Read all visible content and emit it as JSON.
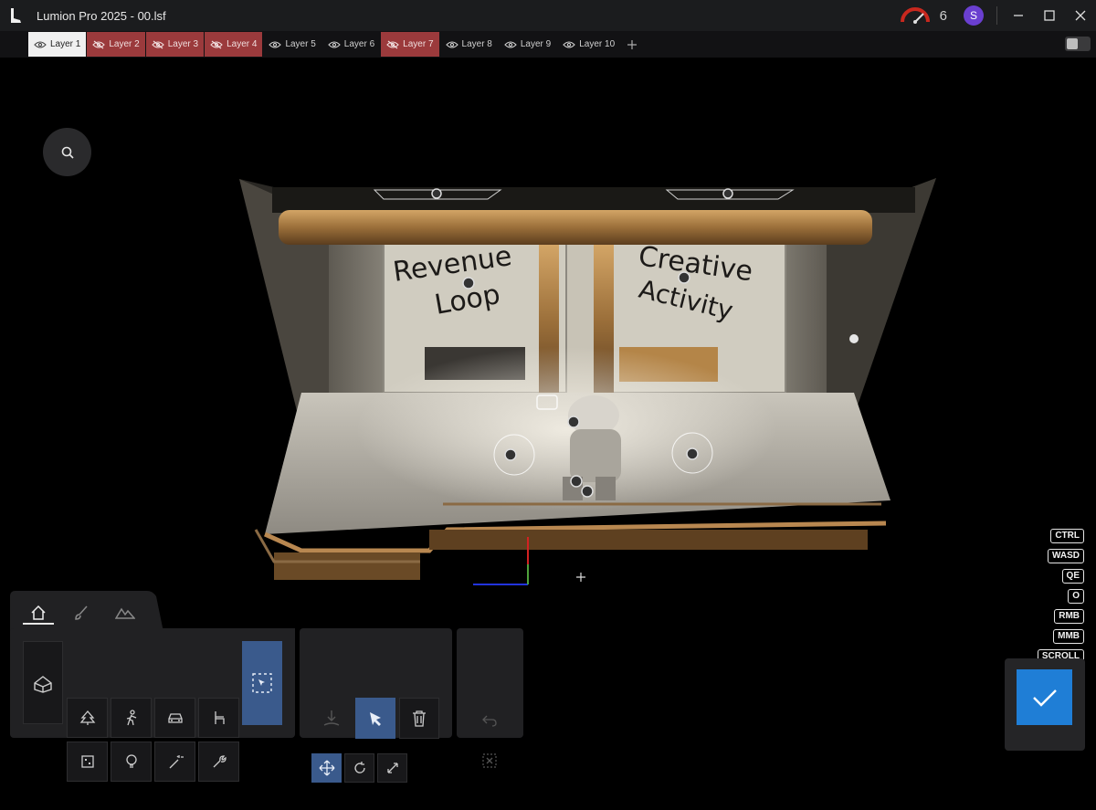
{
  "app": {
    "title": "Lumion Pro 2025 - 00.lsf",
    "performance_count": "6",
    "user_initial": "S"
  },
  "layers": [
    {
      "label": "Layer 1",
      "state": "active"
    },
    {
      "label": "Layer 2",
      "state": "hidden"
    },
    {
      "label": "Layer 3",
      "state": "hidden"
    },
    {
      "label": "Layer 4",
      "state": "hidden"
    },
    {
      "label": "Layer 5",
      "state": "visible"
    },
    {
      "label": "Layer 6",
      "state": "visible"
    },
    {
      "label": "Layer 7",
      "state": "hidden"
    },
    {
      "label": "Layer 8",
      "state": "visible"
    },
    {
      "label": "Layer 9",
      "state": "visible"
    },
    {
      "label": "Layer 10",
      "state": "visible"
    }
  ],
  "scene": {
    "graffiti_left": [
      "Revenue",
      "Loop"
    ],
    "graffiti_right": [
      "Creative",
      "Activity"
    ]
  },
  "shortcuts": [
    "CTRL",
    "WASD",
    "QE",
    "O",
    "RMB",
    "MMB",
    "SCROLL"
  ],
  "mode_tabs": [
    {
      "icon": "home-icon",
      "selected": true
    },
    {
      "icon": "brush-icon",
      "selected": false
    },
    {
      "icon": "landscape-icon",
      "selected": false
    }
  ],
  "categories": [
    {
      "icon": "tree-icon"
    },
    {
      "icon": "person-icon"
    },
    {
      "icon": "car-icon"
    },
    {
      "icon": "chair-icon"
    },
    {
      "icon": "cube-icon"
    },
    {
      "icon": "lightbulb-icon"
    },
    {
      "icon": "magic-wand-icon"
    },
    {
      "icon": "wrench-icon"
    }
  ],
  "colors": {
    "accent": "#1f7ed6",
    "hidden_layer": "#9b3a3c",
    "selected_tool": "#3a5a8c",
    "avatar": "#6a3fd0"
  }
}
